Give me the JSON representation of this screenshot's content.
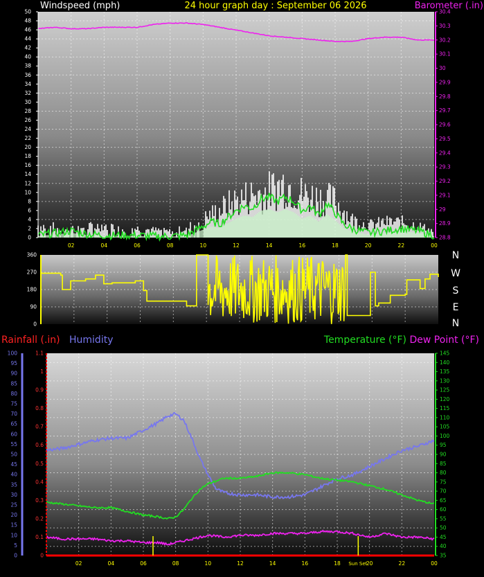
{
  "headers": {
    "title": "24 hour graph day : September 06 2026",
    "windspeed": "Windspeed (mph)",
    "barometer": "Barometer (.in)",
    "rainfall": "Rainfall (.in)",
    "humidity": "Humidity",
    "temperature": "Temperature (°F)",
    "dewpoint": "Dew Point (°F)"
  },
  "compass": [
    "N",
    "W",
    "S",
    "E",
    "N"
  ],
  "x_ticks": [
    "02",
    "04",
    "06",
    "08",
    "10",
    "12",
    "14",
    "16",
    "18",
    "20",
    "22",
    "00"
  ],
  "sunset_label": "Sun Set",
  "colors": {
    "windspeed": "#ffffff",
    "wind_avg": "#22dd22",
    "wind_fill": "#c8f0c8",
    "barometer": "#ee22ee",
    "direction": "#ffff00",
    "temperature": "#22dd22",
    "humidity": "#7777ee",
    "dewpoint": "#ee22ee",
    "rain": "#ff0000",
    "sun_marker": "#ffff00"
  },
  "chart_data": [
    {
      "type": "line",
      "name": "wind-and-barometer",
      "x_range": [
        0,
        24
      ],
      "y_left": {
        "label": "Windspeed (mph)",
        "range": [
          0,
          50
        ],
        "ticks": [
          0,
          2,
          4,
          6,
          8,
          10,
          12,
          14,
          16,
          18,
          20,
          22,
          24,
          26,
          28,
          30,
          32,
          34,
          36,
          38,
          40,
          42,
          44,
          46,
          48,
          50
        ]
      },
      "y_right": {
        "label": "Barometer (.in)",
        "range": [
          28.8,
          30.4
        ],
        "ticks": [
          "28.8",
          "28.9",
          "29",
          "29.1",
          "29.2",
          "29.3",
          "29.4",
          "29.5",
          "29.6",
          "29.7",
          "29.8",
          "29.9",
          "30",
          "30.1",
          "30.2",
          "30.3",
          "30.4"
        ]
      },
      "series": [
        {
          "name": "Barometer (.in)",
          "axis": "right",
          "x": [
            0,
            1,
            2,
            3,
            4,
            5,
            6,
            7,
            8,
            9,
            10,
            11,
            12,
            13,
            14,
            15,
            16,
            17,
            18,
            19,
            20,
            21,
            22,
            23,
            24
          ],
          "y": [
            30.28,
            30.29,
            30.28,
            30.28,
            30.29,
            30.29,
            30.29,
            30.31,
            30.32,
            30.32,
            30.31,
            30.29,
            30.27,
            30.25,
            30.23,
            30.22,
            30.21,
            30.2,
            30.19,
            30.19,
            30.21,
            30.22,
            30.22,
            30.2,
            30.2
          ]
        },
        {
          "name": "Wind average",
          "axis": "left",
          "x": [
            0,
            1,
            2,
            3,
            4,
            5,
            6,
            7,
            8,
            9,
            9.5,
            10,
            10.5,
            11,
            11.5,
            12,
            12.5,
            13,
            13.5,
            14,
            14.5,
            15,
            15.5,
            16,
            16.5,
            17,
            17.5,
            18,
            18.5,
            19,
            20,
            21,
            22,
            23,
            24
          ],
          "y": [
            0.5,
            1.0,
            1.5,
            0.8,
            0.5,
            0.5,
            0.5,
            0.3,
            0.3,
            0.5,
            1.5,
            2.5,
            3.5,
            3.0,
            4.5,
            6.0,
            7.0,
            6.5,
            8.5,
            9.0,
            8.0,
            9.0,
            8.0,
            6.0,
            7.0,
            5.0,
            7.5,
            5.5,
            3.0,
            2.0,
            1.0,
            1.5,
            2.0,
            1.5,
            0.5
          ]
        }
      ],
      "gust_envelope": {
        "x": [
          0,
          2,
          4,
          6,
          8,
          9,
          10,
          11,
          12,
          13,
          14,
          15,
          16,
          17,
          18,
          19,
          20,
          21,
          22,
          23,
          24
        ],
        "y": [
          4,
          3,
          4,
          3,
          2,
          3,
          6,
          9,
          12,
          14,
          15,
          18,
          14,
          13,
          12,
          6,
          4,
          5,
          5,
          4,
          2
        ]
      }
    },
    {
      "type": "line",
      "name": "wind-direction",
      "x_range": [
        0,
        24
      ],
      "y_range": [
        0,
        360
      ],
      "y_ticks": [
        0,
        90,
        180,
        270,
        360
      ],
      "series": [
        {
          "name": "Direction",
          "x": [
            0,
            1.2,
            1.3,
            1.8,
            2.7,
            3.3,
            3.8,
            4.3,
            5.7,
            6.2,
            6.4,
            7.5,
            8.8,
            9.3,
            9.4,
            10.1,
            18.4,
            18.5,
            19.8,
            19.9,
            20.2,
            20.4,
            21.1,
            22.0,
            22.1,
            22.9,
            23.2,
            23.5,
            24
          ],
          "y": [
            265,
            255,
            180,
            225,
            235,
            255,
            210,
            215,
            225,
            175,
            120,
            120,
            95,
            95,
            360,
            360,
            360,
            45,
            45,
            270,
            95,
            110,
            150,
            155,
            230,
            185,
            235,
            260,
            245
          ]
        }
      ],
      "variable_band": {
        "from": 10.1,
        "to": 18.4,
        "min": 0,
        "max": 360
      }
    },
    {
      "type": "line",
      "name": "temp-humidity-rain",
      "x_range": [
        0,
        24
      ],
      "y_humidity": {
        "label": "Humidity",
        "range": [
          0,
          100
        ],
        "ticks": [
          0,
          5,
          10,
          15,
          20,
          25,
          30,
          35,
          40,
          45,
          50,
          55,
          60,
          65,
          70,
          75,
          80,
          85,
          90,
          95,
          100
        ]
      },
      "y_rain": {
        "label": "Rainfall (.in)",
        "range": [
          0,
          1.1
        ],
        "ticks": [
          "0",
          "0.1",
          "0.2",
          "0.3",
          "0.4",
          "0.5",
          "0.6",
          "0.7",
          "0.8",
          "0.9",
          "1",
          "1.1"
        ]
      },
      "y_temp": {
        "label": "Temperature (°F)",
        "range": [
          35,
          145
        ],
        "ticks": [
          35,
          40,
          45,
          50,
          55,
          60,
          65,
          70,
          75,
          80,
          85,
          90,
          95,
          100,
          105,
          110,
          115,
          120,
          125,
          130,
          135,
          140,
          145
        ]
      },
      "sunrise_hour": 6.6,
      "sunset_hour": 19.3,
      "series": [
        {
          "name": "Humidity",
          "axis": "humidity",
          "x": [
            0,
            1,
            2,
            3,
            4,
            5,
            6,
            7,
            7.5,
            8,
            8.5,
            9,
            9.5,
            10,
            10.5,
            11,
            12,
            13,
            14,
            15,
            16,
            17,
            18,
            19,
            20,
            21,
            22,
            23,
            24
          ],
          "y": [
            52,
            53,
            55,
            57,
            58,
            58,
            62,
            66,
            69,
            70,
            67,
            58,
            48,
            40,
            33,
            31,
            30,
            30,
            29,
            29,
            30,
            34,
            38,
            40,
            44,
            48,
            52,
            54,
            57
          ]
        },
        {
          "name": "Temperature (°F)",
          "axis": "temp",
          "x": [
            0,
            1,
            2,
            3,
            4,
            5,
            6,
            7,
            7.5,
            8,
            8.5,
            9,
            9.5,
            10,
            11,
            12,
            13,
            14,
            15,
            16,
            17,
            18,
            19,
            20,
            21,
            22,
            23,
            24
          ],
          "y": [
            64,
            63,
            62,
            61,
            61,
            59,
            57,
            56,
            55,
            56,
            60,
            66,
            71,
            74,
            77,
            77,
            78,
            80,
            80,
            79,
            77,
            76,
            75,
            73,
            71,
            68,
            65,
            63
          ]
        },
        {
          "name": "Dew Point (°F)",
          "axis": "temp",
          "x": [
            0,
            1,
            2,
            3,
            4,
            5,
            6,
            7,
            7.5,
            8,
            9,
            10,
            11,
            12,
            13,
            14,
            15,
            16,
            17,
            18,
            19,
            20,
            21,
            22,
            23,
            24
          ],
          "y": [
            45,
            44,
            44,
            44,
            43,
            43,
            42,
            42,
            41,
            42,
            44,
            46,
            45,
            46,
            46,
            47,
            47,
            47,
            48,
            48,
            47,
            45,
            47,
            45,
            45,
            44
          ]
        },
        {
          "name": "Rainfall (.in)",
          "axis": "rain",
          "x": [
            0,
            24
          ],
          "y": [
            0,
            0
          ]
        }
      ]
    }
  ]
}
